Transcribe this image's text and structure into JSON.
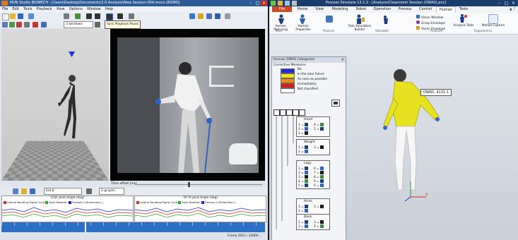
{
  "left_window": {
    "title": "MVN Studio BIOMECH - [Users\\Desktop\\Documents\\3.0 Analysis\\New Session-004.mvnx (BIOM)]",
    "menu": [
      "File",
      "Edit",
      "Tools",
      "Playback",
      "View",
      "Options",
      "Window",
      "Help"
    ],
    "tooltip": "Sync Playback Pause",
    "dropdown_selected": "3 windows",
    "time_offset_label": "Time offset (ms)",
    "bottom_toolbar": {
      "combo1": "Ext b",
      "combo2": "2 graphs"
    },
    "graph1": {
      "title": "L5S1 Joint Angle (deg)",
      "legend": [
        "Lateral Bending Right(+)/Le",
        "Axial Rotation",
        "Flexion(+)/Extension(-)"
      ]
    },
    "graph2": {
      "title": "T8 T6 Joint Angle (deg)",
      "legend": [
        "Lateral Bending Right(+)/Le",
        "Axial Rotation",
        "Flexion(+)/Extension(-)"
      ]
    },
    "status": "Frame 2921 / 14000 ..."
  },
  "right_window": {
    "title": "Process Simulate 13.1.2 - [Analysis/Cleanroom Session (OWAS).psz]",
    "file_tab": "File",
    "tabs": [
      "Home",
      "View",
      "Modeling",
      "Robot",
      "Operation",
      "Process",
      "Control",
      "Human",
      "Tools"
    ],
    "ribbon": {
      "human_posturing": "Human Posturing",
      "human_properties": "Human Properties",
      "task_sim": "Task Simulation Builder",
      "vision_window": "Vision Window",
      "grasp_envelope": "Grasp Envelope",
      "vision_envelope": "Vision Envelope",
      "analysis_tools": "Analysis Tools",
      "motion_capture": "Motion Capture",
      "groups": [
        "Tools",
        "Posture",
        "Simulate",
        "Analyze",
        "Ergonomics"
      ]
    },
    "owas_window": {
      "title": "Human OWAS Categories",
      "corrective_title": "Corrective Measures",
      "legend": [
        {
          "label": "No",
          "color": "#1f2fd6"
        },
        {
          "label": "In the near future",
          "color": "#f2e21c"
        },
        {
          "label": "As soon as possible",
          "color": "#f08a16"
        },
        {
          "label": "Immediately",
          "color": "#d41f1f"
        },
        {
          "label": "Not classified",
          "color": "#ffffff"
        }
      ],
      "groups": [
        {
          "name": "Head",
          "items": [
            "1 =",
            "2 =",
            "3 =",
            "4 =",
            "5 ="
          ]
        },
        {
          "name": "Weight",
          "items": [
            "1 =",
            "2 =",
            "3 ="
          ]
        },
        {
          "name": "Legs",
          "items": [
            "1 =",
            "2 =",
            "3 =",
            "4 =",
            "5 =",
            "6 =",
            "7 =",
            "8 =",
            "9 =",
            "0 ="
          ]
        },
        {
          "name": "Arms",
          "items": [
            "1 =",
            "2 =",
            "3 ="
          ]
        },
        {
          "name": "Back",
          "items": [
            "1 =",
            "2 =",
            "3 =",
            "4 ="
          ]
        }
      ]
    },
    "owas_label": "OWAS:  4131-1"
  }
}
